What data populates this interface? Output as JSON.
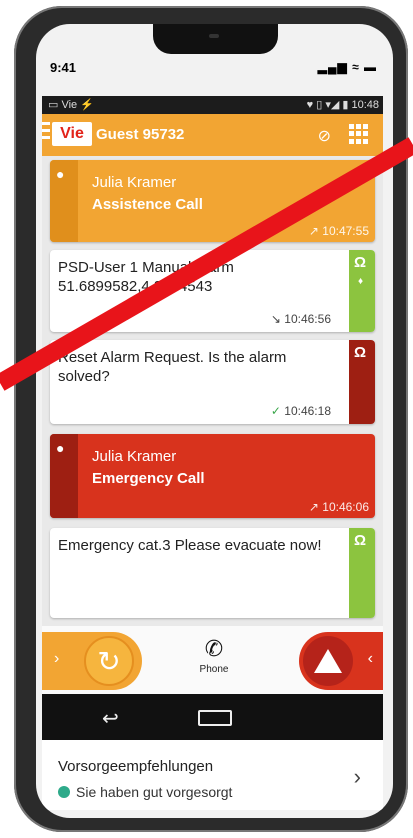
{
  "ios_status": {
    "time": "9:41",
    "icons": "▂▄▆ ≈ ▬"
  },
  "android_status": {
    "left": "▭ Vie ⚡",
    "right": "♥ ▯ ▾◢ ▮ 10:48"
  },
  "appbar": {
    "logo": "Vie",
    "title": "Guest 95732"
  },
  "feed": {
    "call1": {
      "who": "Julia Kramer",
      "what": "Assistence Call",
      "time": "↗ 10:47:55"
    },
    "msg1": {
      "text": "PSD-User 1 Manual Alarm 51.6899582,4.8374543",
      "time": "↘ 10:46:56"
    },
    "msg2": {
      "text": "Reset Alarm Request. Is the alarm solved?",
      "check": "✓",
      "time": "10:46:18"
    },
    "call2": {
      "who": "Julia Kramer",
      "what": "Emergency Call",
      "time": "↗ 10:46:06"
    },
    "msg3": {
      "text": "Emergency cat.3  Please evacuate now!"
    }
  },
  "bottom": {
    "phone_label": "Phone"
  },
  "vorsorge": {
    "title": "Vorsorgeempfehlungen",
    "subtitle": "Sie haben gut vorgesorgt"
  },
  "colors": {
    "orange": "#f2a533",
    "red": "#d8331d",
    "dark_red": "#9e1f12",
    "green": "#8cc43f",
    "teal": "#2eaa8a"
  },
  "icons": [
    "person-icon",
    "headset-icon",
    "location-pin-icon",
    "mute-icon",
    "grid-menu-icon",
    "reset-icon",
    "phone-icon",
    "alarm-icon",
    "back-icon",
    "home-icon",
    "chevron-right-icon"
  ]
}
